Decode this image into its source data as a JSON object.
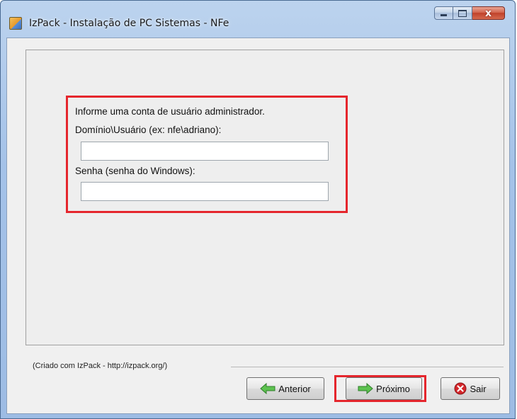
{
  "window": {
    "title": "IzPack - Instalação de PC Sistemas - NFe",
    "minimize_icon": "minimize-icon",
    "maximize_icon": "maximize-icon",
    "close_icon": "close-icon",
    "close_glyph": "x"
  },
  "form": {
    "heading": "Informe uma conta de usuário administrador.",
    "user_label": "Domínio\\Usuário (ex: nfe\\adriano):",
    "user_value": "",
    "password_label": "Senha (senha do Windows):",
    "password_value": ""
  },
  "footer": {
    "credit": "(Criado com IzPack - http://izpack.org/)"
  },
  "buttons": {
    "previous": "Anterior",
    "next": "Próximo",
    "exit": "Sair"
  },
  "icons": {
    "app": "izpack-installer-icon",
    "previous": "green-left-arrow-icon",
    "next": "green-right-arrow-icon",
    "exit": "red-x-circle-icon"
  },
  "colors": {
    "highlight": "#e5262d",
    "arrow_green": "#3aa635",
    "exit_red": "#d4262a"
  }
}
